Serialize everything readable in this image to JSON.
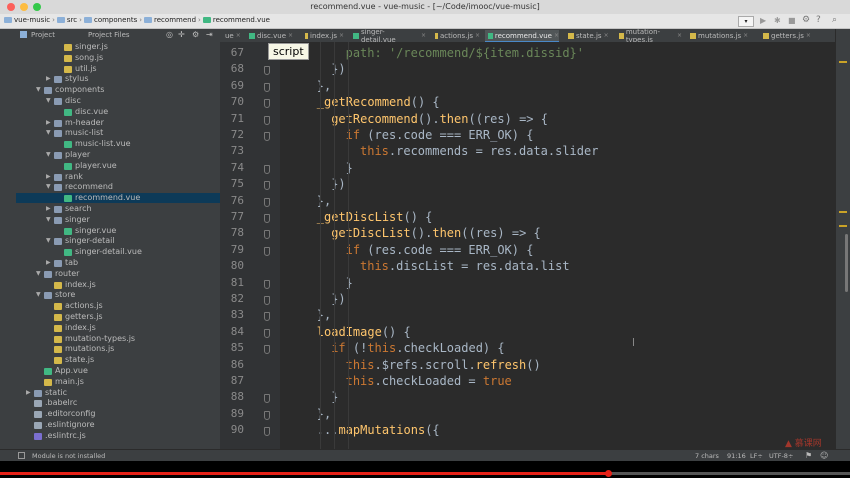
{
  "window": {
    "title": "recommend.vue - vue-music - [~/Code/imooc/vue-music]"
  },
  "breadcrumb": [
    "vue-music",
    "src",
    "components",
    "recommend",
    "recommend.vue"
  ],
  "project_panel": {
    "tab_project": "Project",
    "tab_files": "Project Files"
  },
  "editor_tabs": [
    {
      "label": "ue",
      "active": false
    },
    {
      "label": "disc.vue",
      "active": false
    },
    {
      "label": "index.js",
      "active": false
    },
    {
      "label": "singer-detail.vue",
      "active": false
    },
    {
      "label": "actions.js",
      "active": false
    },
    {
      "label": "recommend.vue",
      "active": true
    },
    {
      "label": "state.js",
      "active": false
    },
    {
      "label": "mutation-types.js",
      "active": false
    },
    {
      "label": "mutations.js",
      "active": false
    },
    {
      "label": "getters.js",
      "active": false
    }
  ],
  "tree": [
    {
      "label": "singer.js",
      "depth": 4,
      "type": "js"
    },
    {
      "label": "song.js",
      "depth": 4,
      "type": "js"
    },
    {
      "label": "util.js",
      "depth": 4,
      "type": "js"
    },
    {
      "label": "stylus",
      "depth": 3,
      "type": "folder",
      "open": false
    },
    {
      "label": "components",
      "depth": 2,
      "type": "folder",
      "open": true
    },
    {
      "label": "disc",
      "depth": 3,
      "type": "folder",
      "open": true
    },
    {
      "label": "disc.vue",
      "depth": 4,
      "type": "vue"
    },
    {
      "label": "m-header",
      "depth": 3,
      "type": "folder",
      "open": false
    },
    {
      "label": "music-list",
      "depth": 3,
      "type": "folder",
      "open": true
    },
    {
      "label": "music-list.vue",
      "depth": 4,
      "type": "vue"
    },
    {
      "label": "player",
      "depth": 3,
      "type": "folder",
      "open": true
    },
    {
      "label": "player.vue",
      "depth": 4,
      "type": "vue"
    },
    {
      "label": "rank",
      "depth": 3,
      "type": "folder",
      "open": false
    },
    {
      "label": "recommend",
      "depth": 3,
      "type": "folder",
      "open": true
    },
    {
      "label": "recommend.vue",
      "depth": 4,
      "type": "vue",
      "selected": true
    },
    {
      "label": "search",
      "depth": 3,
      "type": "folder",
      "open": false
    },
    {
      "label": "singer",
      "depth": 3,
      "type": "folder",
      "open": true
    },
    {
      "label": "singer.vue",
      "depth": 4,
      "type": "vue"
    },
    {
      "label": "singer-detail",
      "depth": 3,
      "type": "folder",
      "open": true
    },
    {
      "label": "singer-detail.vue",
      "depth": 4,
      "type": "vue"
    },
    {
      "label": "tab",
      "depth": 3,
      "type": "folder",
      "open": false
    },
    {
      "label": "router",
      "depth": 2,
      "type": "folder",
      "open": true
    },
    {
      "label": "index.js",
      "depth": 3,
      "type": "js"
    },
    {
      "label": "store",
      "depth": 2,
      "type": "folder",
      "open": true
    },
    {
      "label": "actions.js",
      "depth": 3,
      "type": "js"
    },
    {
      "label": "getters.js",
      "depth": 3,
      "type": "js"
    },
    {
      "label": "index.js",
      "depth": 3,
      "type": "js"
    },
    {
      "label": "mutation-types.js",
      "depth": 3,
      "type": "js"
    },
    {
      "label": "mutations.js",
      "depth": 3,
      "type": "js"
    },
    {
      "label": "state.js",
      "depth": 3,
      "type": "js"
    },
    {
      "label": "App.vue",
      "depth": 2,
      "type": "vue"
    },
    {
      "label": "main.js",
      "depth": 2,
      "type": "js"
    },
    {
      "label": "static",
      "depth": 1,
      "type": "folder",
      "open": false
    },
    {
      "label": ".babelrc",
      "depth": 1,
      "type": "cfg"
    },
    {
      "label": ".editorconfig",
      "depth": 1,
      "type": "cfg"
    },
    {
      "label": ".eslintignore",
      "depth": 1,
      "type": "cfg"
    },
    {
      "label": ".eslintrc.js",
      "depth": 1,
      "type": "eslint"
    }
  ],
  "code_lines": [
    {
      "num": "67",
      "indent": 8,
      "tokens": [
        [
          "path: '/recommend/${item.dissid}'",
          "#6a8759"
        ]
      ]
    },
    {
      "num": "68",
      "indent": 6,
      "tokens": [
        [
          "})",
          "#a9b7c6"
        ]
      ]
    },
    {
      "num": "69",
      "indent": 4,
      "tokens": [
        [
          "},",
          "#a9b7c6"
        ]
      ]
    },
    {
      "num": "70",
      "indent": 4,
      "tokens": [
        [
          "_getRecommend",
          "#ffc66d"
        ],
        [
          "() {",
          "#a9b7c6"
        ]
      ]
    },
    {
      "num": "71",
      "indent": 6,
      "tokens": [
        [
          "getRecommend",
          "#ffc66d"
        ],
        [
          "().",
          "#a9b7c6"
        ],
        [
          "then",
          "#ffc66d"
        ],
        [
          "((",
          "#a9b7c6"
        ],
        [
          "res",
          "#a9b7c6"
        ],
        [
          ") => {",
          "#a9b7c6"
        ]
      ]
    },
    {
      "num": "72",
      "indent": 8,
      "tokens": [
        [
          "if",
          "#cc7832"
        ],
        [
          " (res.",
          "#a9b7c6"
        ],
        [
          "code",
          "#a9b7c6"
        ],
        [
          " === ERR_OK) {",
          "#a9b7c6"
        ]
      ]
    },
    {
      "num": "73",
      "indent": 10,
      "tokens": [
        [
          "this",
          "#cc7832"
        ],
        [
          ".recommends = ",
          "#a9b7c6"
        ],
        [
          "res",
          "#a9b7c6"
        ],
        [
          ".data.slider",
          "#a9b7c6"
        ]
      ]
    },
    {
      "num": "74",
      "indent": 8,
      "tokens": [
        [
          "}",
          "#a9b7c6"
        ]
      ]
    },
    {
      "num": "75",
      "indent": 6,
      "tokens": [
        [
          "})",
          "#a9b7c6"
        ]
      ]
    },
    {
      "num": "76",
      "indent": 4,
      "tokens": [
        [
          "},",
          "#a9b7c6"
        ]
      ]
    },
    {
      "num": "77",
      "indent": 4,
      "tokens": [
        [
          "_getDiscList",
          "#ffc66d"
        ],
        [
          "() {",
          "#a9b7c6"
        ]
      ]
    },
    {
      "num": "78",
      "indent": 6,
      "tokens": [
        [
          "getDiscList",
          "#ffc66d"
        ],
        [
          "().",
          "#a9b7c6"
        ],
        [
          "then",
          "#ffc66d"
        ],
        [
          "((",
          "#a9b7c6"
        ],
        [
          "res",
          "#a9b7c6"
        ],
        [
          ") => {",
          "#a9b7c6"
        ]
      ]
    },
    {
      "num": "79",
      "indent": 8,
      "tokens": [
        [
          "if",
          "#cc7832"
        ],
        [
          " (res.",
          "#a9b7c6"
        ],
        [
          "code",
          "#a9b7c6"
        ],
        [
          " === ERR_OK) {",
          "#a9b7c6"
        ]
      ]
    },
    {
      "num": "80",
      "indent": 10,
      "tokens": [
        [
          "this",
          "#cc7832"
        ],
        [
          ".discList = ",
          "#a9b7c6"
        ],
        [
          "res",
          "#a9b7c6"
        ],
        [
          ".data.list",
          "#a9b7c6"
        ]
      ]
    },
    {
      "num": "81",
      "indent": 8,
      "tokens": [
        [
          "}",
          "#a9b7c6"
        ]
      ]
    },
    {
      "num": "82",
      "indent": 6,
      "tokens": [
        [
          "})",
          "#a9b7c6"
        ]
      ]
    },
    {
      "num": "83",
      "indent": 4,
      "tokens": [
        [
          "},",
          "#a9b7c6"
        ]
      ]
    },
    {
      "num": "84",
      "indent": 4,
      "tokens": [
        [
          "loadImage",
          "#ffc66d"
        ],
        [
          "() {",
          "#a9b7c6"
        ]
      ]
    },
    {
      "num": "85",
      "indent": 6,
      "tokens": [
        [
          "if",
          "#cc7832"
        ],
        [
          " (!",
          "#a9b7c6"
        ],
        [
          "this",
          "#cc7832"
        ],
        [
          ".checkLoaded) {",
          "#a9b7c6"
        ]
      ]
    },
    {
      "num": "86",
      "indent": 8,
      "tokens": [
        [
          "this",
          "#cc7832"
        ],
        [
          ".$refs.",
          "#a9b7c6"
        ],
        [
          "scroll",
          "#a9b7c6"
        ],
        [
          ".",
          "#a9b7c6"
        ],
        [
          "refresh",
          "#ffc66d"
        ],
        [
          "()",
          "#a9b7c6"
        ]
      ]
    },
    {
      "num": "87",
      "indent": 8,
      "tokens": [
        [
          "this",
          "#cc7832"
        ],
        [
          ".checkLoaded = ",
          "#a9b7c6"
        ],
        [
          "true",
          "#cc7832"
        ]
      ]
    },
    {
      "num": "88",
      "indent": 6,
      "tokens": [
        [
          "}",
          "#a9b7c6"
        ]
      ]
    },
    {
      "num": "89",
      "indent": 4,
      "tokens": [
        [
          "},",
          "#a9b7c6"
        ]
      ]
    },
    {
      "num": "90",
      "indent": 4,
      "tokens": [
        [
          "...",
          "#a9b7c6"
        ],
        [
          "mapMutations",
          "#ffc66d"
        ],
        [
          "({",
          "#a9b7c6"
        ]
      ]
    }
  ],
  "tooltip": "script",
  "status": {
    "message": "Module is not installed",
    "chars": "7 chars",
    "position": "91:16",
    "line_sep": "LF÷",
    "encoding": "UTF-8÷"
  },
  "video": {
    "progress_pct": 71.5
  },
  "colors": {
    "accent": "#4a88c7",
    "selection": "#0d3a58",
    "progress": "#e62117"
  }
}
